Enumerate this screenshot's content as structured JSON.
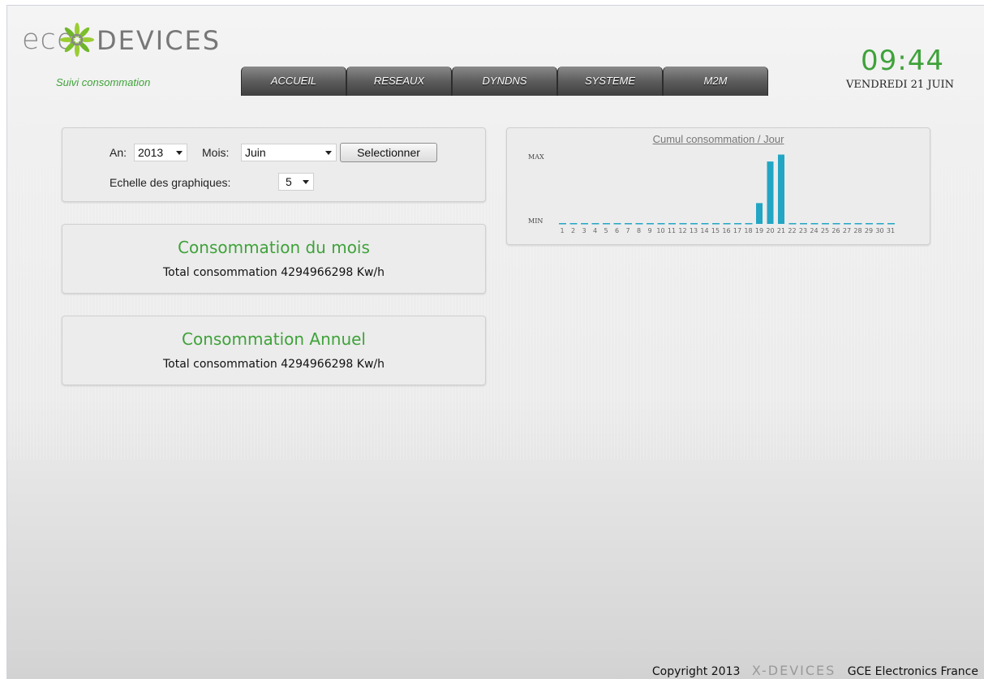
{
  "header": {
    "logo_text_left": "eco",
    "logo_text_right": "DEVICES",
    "subtitle": "Suivi consommation",
    "clock": "09:44",
    "date": "VENDREDI 21 JUIN"
  },
  "tabs": [
    {
      "label": "ACCUEIL"
    },
    {
      "label": "RESEAUX"
    },
    {
      "label": "DYNDNS"
    },
    {
      "label": "SYSTEME"
    },
    {
      "label": "M2M"
    }
  ],
  "selector": {
    "year_label": "An:",
    "year_value": "2013",
    "month_label": "Mois:",
    "month_value": "Juin",
    "select_button": "Selectionner",
    "scale_label": "Echelle des graphiques:",
    "scale_value": "5"
  },
  "month_panel": {
    "title": "Consommation du mois",
    "total": "Total consommation 4294966298 Kw/h"
  },
  "year_panel": {
    "title": "Consommation Annuel",
    "total": "Total consommation 4294966298 Kw/h"
  },
  "chart_data": {
    "type": "bar",
    "title": "Cumul consommation / Jour",
    "ylabel_max": "MAX",
    "ylabel_min": "MIN",
    "categories": [
      "1",
      "2",
      "3",
      "4",
      "5",
      "6",
      "7",
      "8",
      "9",
      "10",
      "11",
      "12",
      "13",
      "14",
      "15",
      "16",
      "17",
      "18",
      "19",
      "20",
      "21",
      "22",
      "23",
      "24",
      "25",
      "26",
      "27",
      "28",
      "29",
      "30",
      "31"
    ],
    "values": [
      0,
      0,
      0,
      0,
      0,
      0,
      0,
      0,
      0,
      0,
      0,
      0,
      0,
      0,
      0,
      0,
      0,
      0,
      0.3,
      0.9,
      1.0,
      0,
      0,
      0,
      0,
      0,
      0,
      0,
      0,
      0,
      0
    ],
    "ylim": [
      0,
      1.1
    ],
    "colors": {
      "bar": "#22a6c4",
      "baseline": "#22a6c4"
    }
  },
  "footer": {
    "copyright": "Copyright 2013",
    "brand": "X-DEVICES",
    "company": "GCE Electronics France"
  },
  "colors": {
    "accent_green": "#3fa23a",
    "tab_dark": "#4a4a4a"
  }
}
